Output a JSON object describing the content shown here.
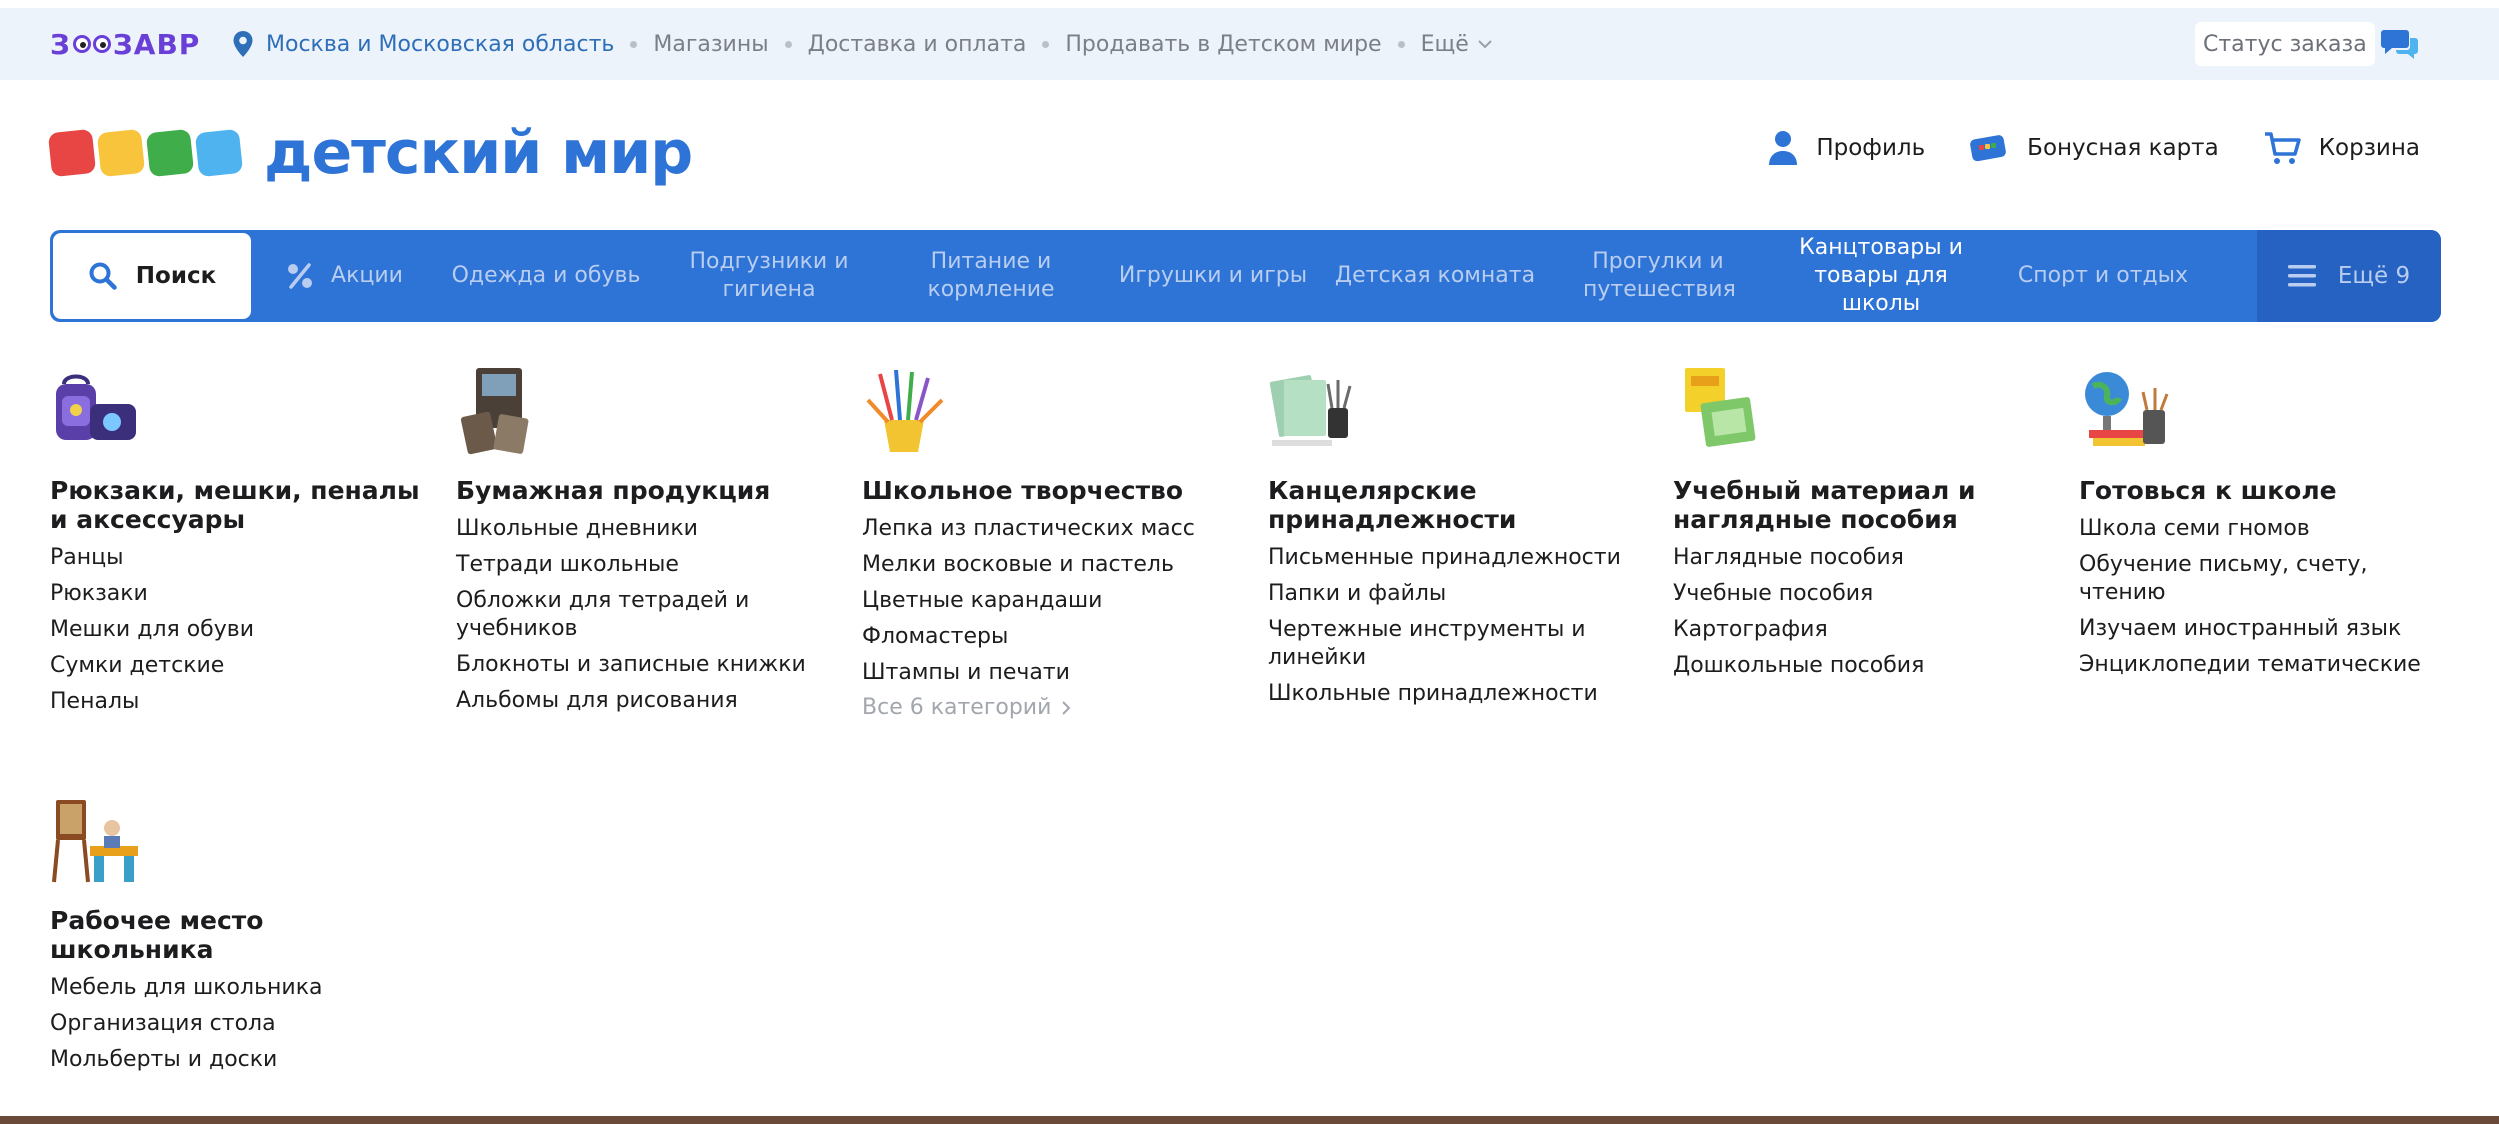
{
  "topbar": {
    "logo_text_left": "З",
    "logo_text_right": "ЗАВР",
    "region": "Москва и Московская область",
    "links": [
      "Магазины",
      "Доставка и оплата",
      "Продавать в Детском мире"
    ],
    "more": "Ещё",
    "order_status": "Статус заказа"
  },
  "header": {
    "brand": "детский мир",
    "profile": "Профиль",
    "bonus_card": "Бонусная карта",
    "cart": "Корзина"
  },
  "nav": {
    "search": "Поиск",
    "items": [
      {
        "label": "Акции"
      },
      {
        "label": "Одежда и обувь"
      },
      {
        "label": "Подгузники и гигиена"
      },
      {
        "label": "Питание и кормление"
      },
      {
        "label": "Игрушки и игры"
      },
      {
        "label": "Детская комната"
      },
      {
        "label": "Прогулки и путешествия"
      },
      {
        "label": "Канцтовары и товары для школы"
      },
      {
        "label": "Спорт и отдых"
      }
    ],
    "more": "Ещё 9"
  },
  "categories": [
    {
      "title": "Рюкзаки, мешки, пеналы и аксессуары",
      "items": [
        "Ранцы",
        "Рюкзаки",
        "Мешки для обуви",
        "Сумки детские",
        "Пеналы"
      ]
    },
    {
      "title": "Бумажная продукция",
      "items": [
        "Школьные дневники",
        "Тетради школьные",
        "Обложки для тетрадей и учебников",
        "Блокноты и записные книжки",
        "Альбомы для рисования"
      ]
    },
    {
      "title": "Школьное творчество",
      "items": [
        "Лепка из пластических масс",
        "Мелки восковые и пастель",
        "Цветные карандаши",
        "Фломастеры",
        "Штампы и печати"
      ],
      "all": "Все 6 категорий"
    },
    {
      "title": "Канцелярские принадлежности",
      "items": [
        "Письменные принадлежности",
        "Папки и файлы",
        "Чертежные инструменты и линейки",
        "Школьные принадлежности"
      ]
    },
    {
      "title": "Учебный материал и наглядные пособия",
      "items": [
        "Наглядные пособия",
        "Учебные пособия",
        "Картография",
        "Дошкольные пособия"
      ]
    },
    {
      "title": "Готовься к школе",
      "items": [
        "Школа семи гномов",
        "Обучение письму, счету, чтению",
        "Изучаем иностранный язык",
        "Энциклопедии тематические"
      ]
    },
    {
      "title": "Рабочее место школьника",
      "items": [
        "Мебель для школьника",
        "Организация стола",
        "Мольберты и доски"
      ]
    }
  ],
  "colors": {
    "brand_blue": "#2e73d6",
    "logo_red": "#e84545",
    "logo_yellow": "#f7c43b",
    "logo_green": "#3fae4a",
    "logo_lightblue": "#4fb3f0"
  }
}
